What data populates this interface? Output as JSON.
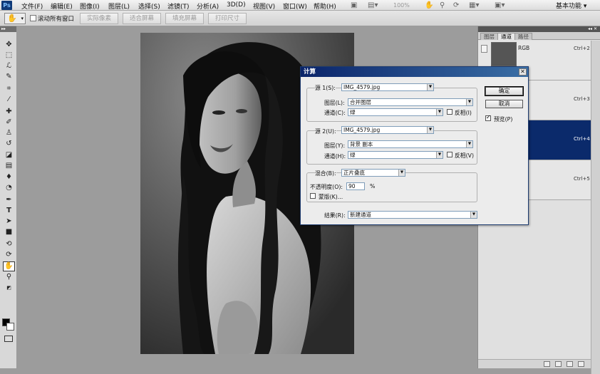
{
  "app": {
    "logo": "Ps"
  },
  "menubar": {
    "menus": [
      "文件(F)",
      "编辑(E)",
      "图像(I)",
      "图层(L)",
      "选择(S)",
      "滤镜(T)",
      "分析(A)",
      "3D(D)",
      "视图(V)",
      "窗口(W)",
      "帮助(H)"
    ],
    "zoom": "100%",
    "workspace": "基本功能 ▾"
  },
  "options": {
    "scroll_all_label": "滚动所有窗口",
    "buttons": [
      "实际像素",
      "适合屏幕",
      "填充屏幕",
      "打印尺寸"
    ]
  },
  "toolbox": {
    "tools": [
      "move-tool-icon",
      "marquee-tool-icon",
      "lasso-tool-icon",
      "quick-select-tool-icon",
      "crop-tool-icon",
      "eyedropper-tool-icon",
      "healing-brush-icon",
      "brush-tool-icon",
      "clone-stamp-icon",
      "history-brush-icon",
      "eraser-tool-icon",
      "gradient-tool-icon",
      "blur-tool-icon",
      "dodge-tool-icon",
      "pen-tool-icon",
      "type-tool-icon",
      "path-select-icon",
      "shape-tool-icon",
      "3d-rotate-icon",
      "3d-orbit-icon",
      "hand-tool-icon",
      "zoom-tool-icon"
    ]
  },
  "panel": {
    "tabs": [
      "图层",
      "通道",
      "路径"
    ],
    "channels": [
      {
        "name": "RGB",
        "shortcut": "Ctrl+2",
        "selected": false
      },
      {
        "name": "",
        "shortcut": "Ctrl+3",
        "selected": false
      },
      {
        "name": "",
        "shortcut": "Ctrl+4",
        "selected": true
      },
      {
        "name": "",
        "shortcut": "Ctrl+5",
        "selected": false
      }
    ]
  },
  "dialog": {
    "title": "计算",
    "source1": {
      "label": "源 1(S):",
      "file": "IMG_4579.jpg",
      "layer_label": "图层(L):",
      "layer": "合并图层",
      "channel_label": "通道(C):",
      "channel": "绿",
      "invert_label": "反相(I)"
    },
    "source2": {
      "label": "源 2(U):",
      "file": "IMG_4579.jpg",
      "layer_label": "图层(Y):",
      "layer": "背景 副本",
      "channel_label": "通道(H):",
      "channel": "绿",
      "invert_label": "反相(V)"
    },
    "blending": {
      "label": "混合(B):",
      "mode": "正片叠底",
      "opacity_label": "不透明度(O):",
      "opacity": "90",
      "opacity_unit": "%",
      "mask_label": "蒙版(K)..."
    },
    "result": {
      "label": "结果(R):",
      "value": "新建通道"
    },
    "ok_label": "确定",
    "cancel_label": "取消",
    "preview_label": "预览(P)"
  }
}
